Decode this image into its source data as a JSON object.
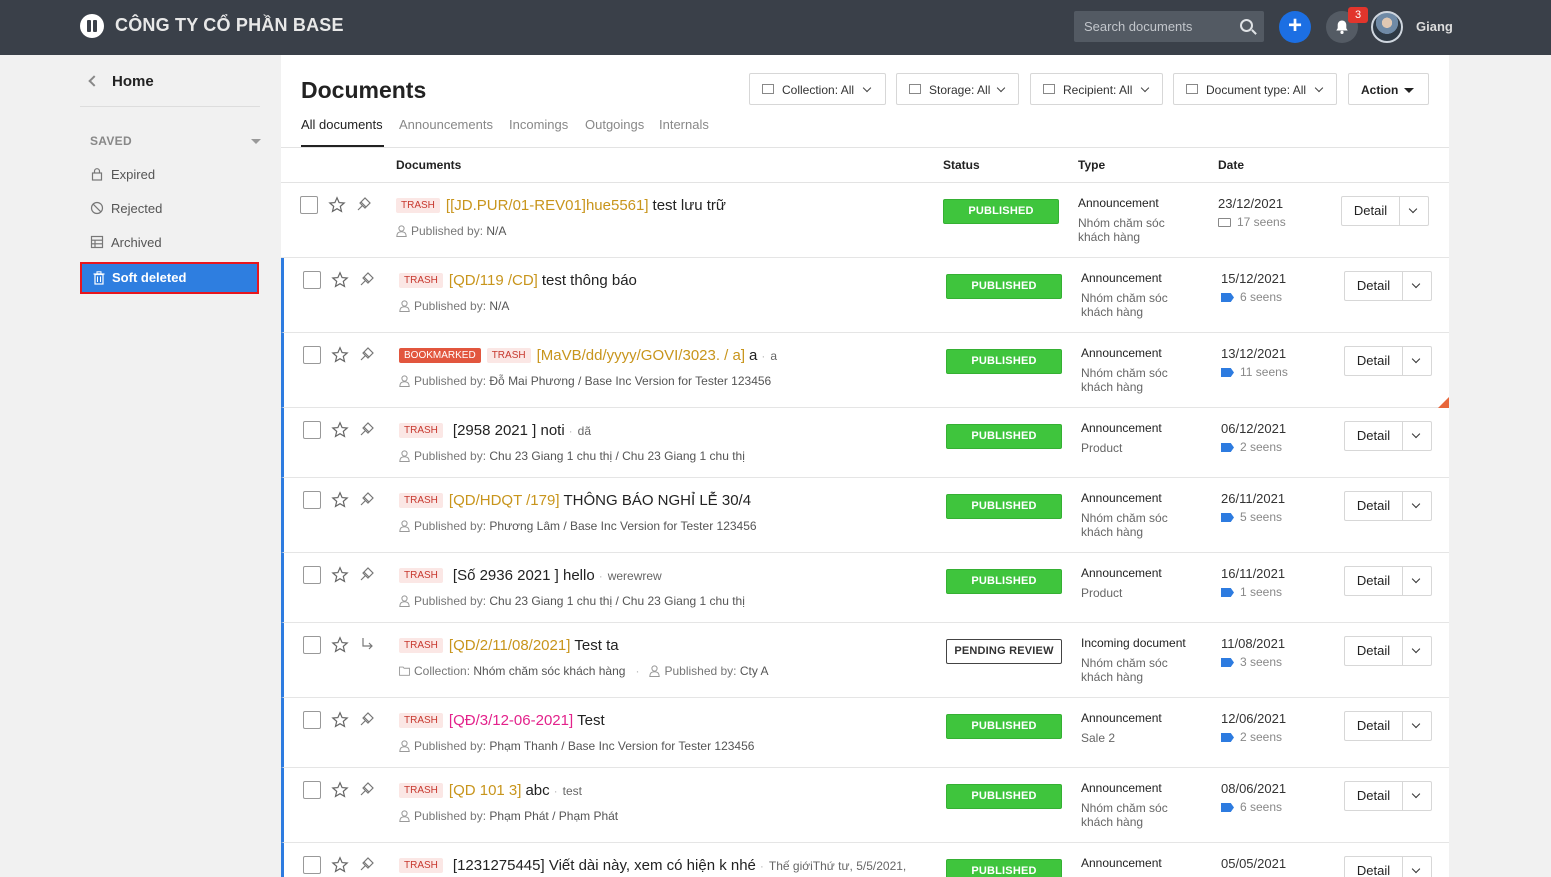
{
  "header": {
    "company": "CÔNG TY CỔ PHẦN BASE",
    "search_placeholder": "Search documents",
    "notification_count": "3",
    "user_name": "Giang",
    "plus_label": "+"
  },
  "sidebar": {
    "home": "Home",
    "saved_label": "SAVED",
    "items": [
      {
        "label": "Expired",
        "icon": "lock-icon"
      },
      {
        "label": "Rejected",
        "icon": "ban-icon"
      },
      {
        "label": "Archived",
        "icon": "archive-icon"
      },
      {
        "label": "Soft deleted",
        "icon": "trash-icon",
        "active": true
      }
    ]
  },
  "main": {
    "title": "Documents",
    "filters": [
      "Collection: All",
      "Storage: All",
      "Recipient: All",
      "Document type: All"
    ],
    "action_label": "Action",
    "tabs": [
      "All documents",
      "Announcements",
      "Incomings",
      "Outgoings",
      "Internals"
    ],
    "columns": {
      "documents": "Documents",
      "status": "Status",
      "type": "Type",
      "date": "Date"
    },
    "detail_label": "Detail",
    "rows": [
      {
        "bookmark": "",
        "trash": "TRASH",
        "code": "[[JD.PUR/01-REV01]hue5561]",
        "title": "test lưu trữ",
        "summary": "",
        "published_label": "Published by:",
        "published": "N/A",
        "collection_label": "",
        "collection": "",
        "status": "PUBLISHED",
        "type": "Announcement",
        "type_sub": "Nhóm chăm sóc khách hàng",
        "date": "23/12/2021",
        "seens": "17 seens"
      },
      {
        "bookmark": "",
        "trash": "TRASH",
        "code": "[QD/119 /CD]",
        "title": "test thông báo",
        "summary": "",
        "published_label": "Published by:",
        "published": "N/A",
        "collection_label": "",
        "collection": "",
        "status": "PUBLISHED",
        "type": "Announcement",
        "type_sub": "Nhóm chăm sóc khách hàng",
        "date": "15/12/2021",
        "seens": "6 seens"
      },
      {
        "bookmark": "BOOKMARKED",
        "trash": "TRASH",
        "code": "[MaVB/dd/yyyy/GOVI/3023. / a]",
        "title": "a",
        "summary": "a",
        "published_label": "Published by:",
        "published": "Đỗ Mai Phương / Base Inc Version for Tester 123456",
        "collection_label": "",
        "collection": "",
        "status": "PUBLISHED",
        "type": "Announcement",
        "type_sub": "Nhóm chăm sóc khách hàng",
        "date": "13/12/2021",
        "seens": "11 seens"
      },
      {
        "bookmark": "",
        "trash": "TRASH",
        "code": "",
        "title": "[2958 2021 ] noti",
        "summary": "dã",
        "published_label": "Published by:",
        "published": "Chu 23 Giang 1 chu thị / Chu 23 Giang 1 chu thị",
        "collection_label": "",
        "collection": "",
        "status": "PUBLISHED",
        "type": "Announcement",
        "type_sub": "Product",
        "date": "06/12/2021",
        "seens": "2 seens"
      },
      {
        "bookmark": "",
        "trash": "TRASH",
        "code": "[QD/HDQT /179]",
        "title": "THÔNG BÁO NGHỈ LỄ 30/4",
        "summary": "",
        "published_label": "Published by:",
        "published": "Phương Lâm / Base Inc Version for Tester 123456",
        "collection_label": "",
        "collection": "",
        "status": "PUBLISHED",
        "type": "Announcement",
        "type_sub": "Nhóm chăm sóc khách hàng",
        "date": "26/11/2021",
        "seens": "5 seens"
      },
      {
        "bookmark": "",
        "trash": "TRASH",
        "code": "",
        "title": "[Số 2936 2021 ] hello",
        "summary": "werewrew",
        "published_label": "Published by:",
        "published": "Chu 23 Giang 1 chu thị / Chu 23 Giang 1 chu thị",
        "collection_label": "",
        "collection": "",
        "status": "PUBLISHED",
        "type": "Announcement",
        "type_sub": "Product",
        "date": "16/11/2021",
        "seens": "1 seens"
      },
      {
        "bookmark": "",
        "trash": "TRASH",
        "code": "[QD/2/11/08/2021]",
        "title": "Test ta",
        "summary": "",
        "published_label": "Published by:",
        "published": "Cty A",
        "collection_label": "Collection:",
        "collection": "Nhóm chăm sóc khách hàng",
        "status": "PENDING REVIEW",
        "type": "Incoming document",
        "type_sub": "Nhóm chăm sóc khách hàng",
        "date": "11/08/2021",
        "seens": "3 seens"
      },
      {
        "bookmark": "",
        "trash": "TRASH",
        "code": "[QĐ/3/12-06-2021]",
        "title": "Test",
        "summary": "",
        "published_label": "Published by:",
        "published": "Phạm Thanh / Base Inc Version for Tester 123456",
        "collection_label": "",
        "collection": "",
        "status": "PUBLISHED",
        "type": "Announcement",
        "type_sub": "Sale 2",
        "date": "12/06/2021",
        "seens": "2 seens"
      },
      {
        "bookmark": "",
        "trash": "TRASH",
        "code": "[QD 101 3]",
        "title": "abc",
        "summary": "test",
        "published_label": "Published by:",
        "published": "Phạm Phát / Phạm Phát",
        "collection_label": "",
        "collection": "",
        "status": "PUBLISHED",
        "type": "Announcement",
        "type_sub": "Nhóm chăm sóc khách hàng",
        "date": "08/06/2021",
        "seens": "6 seens"
      },
      {
        "bookmark": "",
        "trash": "TRASH",
        "code": "",
        "title": "[1231275445] Viết dài này, xem có hiện k nhé",
        "summary": "Thế giớiThứ tư, 5/5/2021,",
        "published_label": "",
        "published": "",
        "collection_label": "",
        "collection": "",
        "status": "PUBLISHED",
        "type": "Announcement",
        "type_sub": "",
        "date": "05/05/2021",
        "seens": ""
      }
    ]
  }
}
